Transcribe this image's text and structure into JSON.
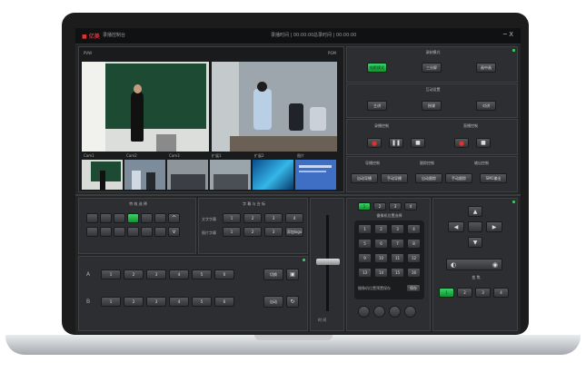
{
  "app": {
    "logo": "■ 亿美",
    "title": "录播控制台",
    "record_time": "录播时间 | 00:00:00",
    "total_time": "总录时间 | 00:00:00",
    "win_ctl": "─ X"
  },
  "preview": {
    "left_label": "PVW",
    "right_label": "PGM"
  },
  "thumbs": [
    "Cam1",
    "Cam2",
    "Cam3",
    "扩展1",
    "扩展2",
    "图片"
  ],
  "record_mode": {
    "title": "录制模式",
    "options": [
      "电影模式",
      "三分屏",
      "画中画"
    ]
  },
  "interaction": {
    "title": "互动设置",
    "options": [
      "主讲",
      "授课",
      "对讲"
    ]
  },
  "record_ctrl": {
    "title": "录播控制",
    "live_title": "直播控制"
  },
  "controls": {
    "titles": [
      "导播控制",
      "跟踪控制",
      "输出控制"
    ],
    "labels": [
      "自动导播",
      "手动导播",
      "自动跟踪",
      "手动跟踪",
      "SMC输出"
    ]
  },
  "effects": {
    "title": "特 效 选 择"
  },
  "subtitle": {
    "title": "字 幕 与 台 标",
    "rows": [
      "文字字幕",
      "图片字幕"
    ],
    "nums": [
      "1",
      "2",
      "3",
      "4"
    ],
    "add": "添加logo"
  },
  "bus": {
    "rows": [
      "A",
      "B"
    ],
    "nums": [
      "1",
      "2",
      "3",
      "4",
      "5",
      "6"
    ],
    "actions": [
      "切换",
      "自动"
    ]
  },
  "tbar": {
    "label": "时 间"
  },
  "camera": {
    "title": "摄像机位置选择",
    "presets": [
      "1",
      "2",
      "3",
      "4",
      "5",
      "6",
      "7",
      "8",
      "9",
      "10",
      "11",
      "12",
      "13",
      "14",
      "15",
      "16"
    ],
    "save": "摄像机位置预置保存",
    "save_btn": "保存",
    "top_nums": [
      "1",
      "2",
      "3",
      "4"
    ]
  },
  "ptz": {
    "focus_label": "变 焦",
    "speeds": [
      "1",
      "2",
      "3",
      "4"
    ]
  }
}
